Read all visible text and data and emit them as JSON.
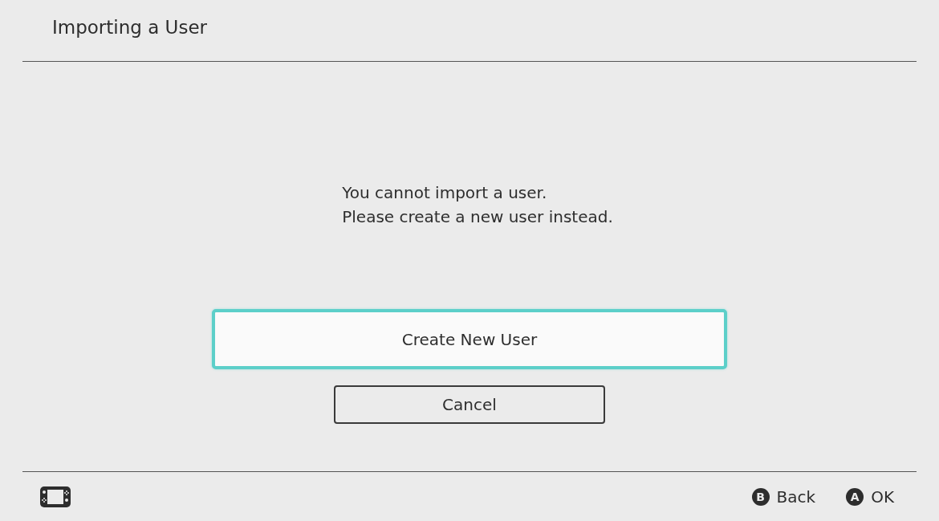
{
  "header": {
    "title": "Importing a User"
  },
  "message": [
    "You cannot import a user.",
    "Please create a new user instead."
  ],
  "buttons": [
    {
      "label": "Create New User",
      "selected": true,
      "kind": "wide"
    },
    {
      "label": "Cancel",
      "selected": false,
      "kind": "narrow"
    }
  ],
  "footer": {
    "hints": [
      {
        "key": "B",
        "label": "Back"
      },
      {
        "key": "A",
        "label": "OK"
      }
    ]
  }
}
